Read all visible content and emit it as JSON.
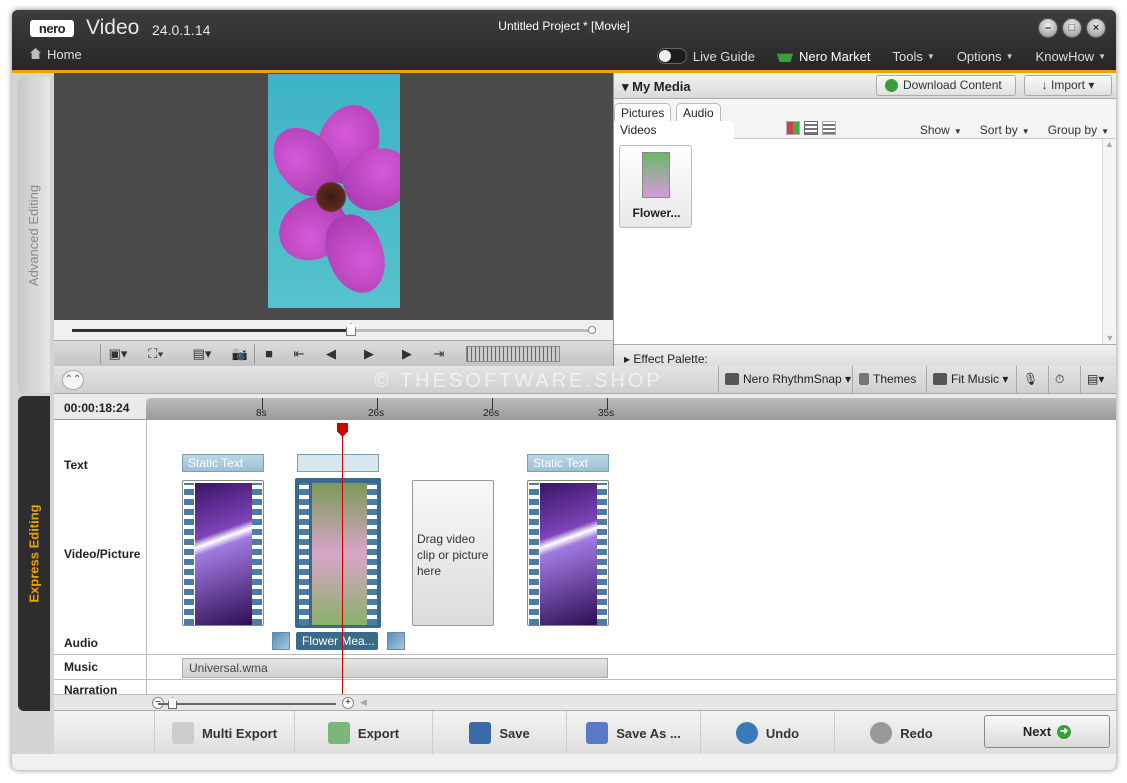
{
  "app": {
    "logo": "nero",
    "name": "Video",
    "version": "24.0.1.14",
    "project_title": "Untitled Project * [Movie]"
  },
  "nav": {
    "home": "Home",
    "live_guide": "Live Guide",
    "market": "Nero Market",
    "tools": "Tools",
    "options": "Options",
    "knowhow": "KnowHow"
  },
  "side_tabs": {
    "advanced": "Advanced Editing",
    "express": "Express Editing"
  },
  "media": {
    "title": "My Media",
    "download": "Download Content",
    "import": "Import",
    "tabs": [
      "Pictures",
      "Audio",
      "Videos"
    ],
    "show": "Show",
    "sort_by": "Sort by",
    "group_by": "Group by",
    "items": [
      {
        "label": "Flower..."
      }
    ],
    "effect_palette": "Effect Palette:"
  },
  "toolbar": {
    "watermark": "© THESOFTWARE.SHOP",
    "rhythm": "Nero RhythmSnap",
    "themes": "Themes",
    "fit_music": "Fit Music"
  },
  "timeline": {
    "timecode": "00:00:18:24",
    "ticks": [
      "8s",
      "26s",
      "26s",
      "35s"
    ],
    "tracks": {
      "text": "Text",
      "video": "Video/Picture",
      "audio": "Audio",
      "music": "Music",
      "narration": "Narration"
    },
    "text_clips": [
      "Static Text",
      "",
      "Static Text"
    ],
    "dropzone": "Drag video clip or picture here",
    "audio_clip": "Flower Mea...",
    "music_clip": "Universal.wma"
  },
  "bottom": {
    "multi_export": "Multi Export",
    "export": "Export",
    "save": "Save",
    "save_as": "Save As ...",
    "undo": "Undo",
    "redo": "Redo",
    "next": "Next"
  },
  "colors": {
    "accent": "#f0a000",
    "selected_clip": "#3a6a8a",
    "playhead": "#cc0000"
  }
}
